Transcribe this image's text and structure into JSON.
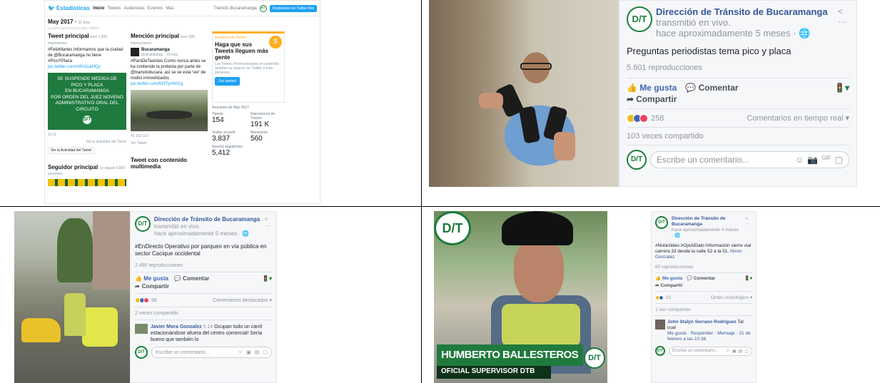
{
  "twitter": {
    "brand": "Estadísticas",
    "nav": [
      "Inicio",
      "Tweets",
      "Audiencias",
      "Eventos",
      "Más"
    ],
    "account": "Tránsito Bucaramanga",
    "ads_button": "Registrarse en Twitter Ads",
    "month": "May 2017",
    "month_days": "31 días",
    "summary_label": "Lo más destacado del Tweet",
    "top_tweet": {
      "title": "Tweet principal",
      "title_sub": "tuvo 1.836 impresiones",
      "text": "#FelizMartes Informamos que la ciudad de @Bucaramanga no tiene #PicoYPlaca",
      "link": "pic.twitter.com/vWn2uaHQy",
      "image_lines": [
        "SE SUSPENDE MEDIDA DE",
        "PICO Y PLACA",
        "EN BUCARAMANGA",
        "POR ORDEN DEL JUEZ NOVENO",
        "ADMINISTRATIVO ORAL DEL CIRCUITO"
      ],
      "metrics": "13   11",
      "view_activity": "Ver la actividad del Tweet",
      "view_activity_box": "Ver la Actividad del Tweet"
    },
    "top_mention": {
      "title": "Mención principal",
      "title_sub": "tuvo 18K interacciones",
      "account_name": "Bucaramanga",
      "handle": "@alcaldiabga · 19 may",
      "text": "#ParoDeTaxistas Como nunca antes se ha contenido la protesta por parte de @transitobucara, así se ve esta 'ver' de nodos inmovilizados",
      "link": "pic.twitter.com/6XfTyvWrCq",
      "metrics": "41   153   110",
      "view_tweet": "Ver Tweet"
    },
    "promo": {
      "label": "Anuncios de Twitter",
      "title": "Haga que sus Tweets lleguen más gente",
      "text": "Los Tweets Promocionados el contenido amplían su alcance en Twitter a más personas.",
      "button": "Get started"
    },
    "summary": {
      "label": "Resumen de May 2017",
      "items": [
        {
          "label": "Tweets",
          "value": "154"
        },
        {
          "label": "Impresiones de Tweets",
          "value": "191 K"
        },
        {
          "label": "Visitas al perfil",
          "value": "3,837"
        },
        {
          "label": "Menciones",
          "value": "560"
        },
        {
          "label": "Nuevos seguidores",
          "value": "5,412"
        }
      ]
    },
    "top_follower": {
      "title": "Seguidor principal",
      "title_sub": "Lo siguen 6.883",
      "sub": "personas"
    },
    "media_tweet": "Tweet con contenido multimedia"
  },
  "fb1": {
    "page": "Dirección de Tránsito de Bucaramanga",
    "action": "transmitió en vivo.",
    "time": "hace aproximadamente 5 meses",
    "text": "Preguntas periodistas tema pico y placa",
    "views": "5.601 reproducciones",
    "like": "Me gusta",
    "comment": "Comentar",
    "share": "Compartir",
    "reaction_count": "258",
    "comments_mode": "Comentarios en tiempo real",
    "shared": "103 veces compartido",
    "write": "Escribe un comentario..."
  },
  "fb2": {
    "page": "Dirección de Tránsito de Bucaramanga",
    "action": "transmitió en vivo.",
    "time": "hace aproximadamente 5 meses",
    "text": "#EnDirecto Operativo por parqueo en vía pública en sector Cacique occidental",
    "views": "2.490 reproducciones",
    "like": "Me gusta",
    "comment": "Comentar",
    "share": "Compartir",
    "reaction_count": "98",
    "comments_mode": "Comentarios destacados",
    "shared": "2 veces compartido",
    "commenter": "Javier Mora Gonzalez",
    "comment_time": "5:14",
    "comment_text": "Ocupan todo un carril estacionándose afuera del centro comercial! Sería bueno que también lo",
    "write": "Escribe un comentario..."
  },
  "fb3": {
    "page": "Dirección de Tránsito de Bucaramanga",
    "time": "hace aproximadamente 4 meses",
    "text": "#NotaVideo #OjoAlDato Información cierre vial carrera 33 desde la calle 52 a la 51.",
    "mention": "Nixon Gonzalez",
    "views": "60 reproducciones",
    "like": "Me gusta",
    "comment": "Comentar",
    "share": "Compartir",
    "reaction_count": "15",
    "comments_mode": "Orden cronológico",
    "shared": "1 vez compartido",
    "commenter": "John Stalyn Serrano Rodriguez",
    "comment_text": "Tal cual",
    "comment_meta": "Me gusta · Responder · Mensaje · 21 de febrero a las 22:36",
    "write": "Escribe un comentario..."
  },
  "video3": {
    "name": "HUMBERTO BALLESTEROS",
    "role": "OFICIAL SUPERVISOR DTB"
  },
  "logo_text": "D/T",
  "colors": {
    "fb_blue": "#365899",
    "twitter_blue": "#1da1f2",
    "dtb_green": "#1f7a3f"
  }
}
